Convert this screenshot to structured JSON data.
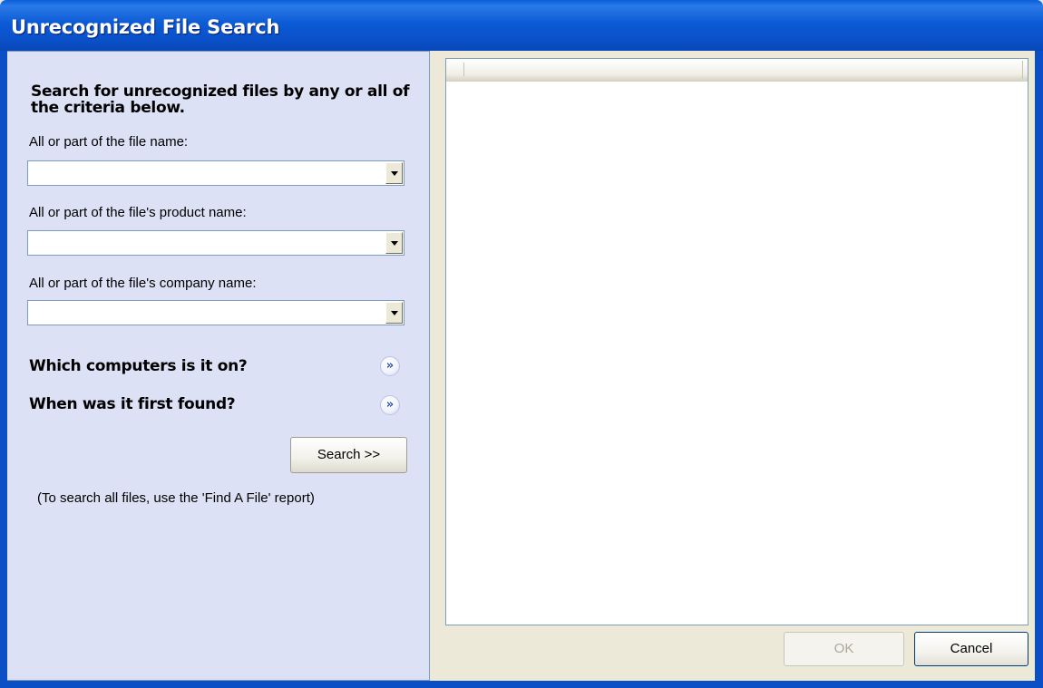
{
  "window": {
    "title": "Unrecognized File Search"
  },
  "search_panel": {
    "heading": "Search for unrecognized files by any or all of the criteria below.",
    "file_name": {
      "label": "All or part of the file name:",
      "value": ""
    },
    "product_name": {
      "label": "All or part of the file's product name:",
      "value": ""
    },
    "company_name": {
      "label": "All or part of the file's company name:",
      "value": ""
    },
    "computers_section": {
      "label": "Which computers is it on?",
      "icon": "expand-chevron-down-icon"
    },
    "first_found_section": {
      "label": "When was it first found?",
      "icon": "expand-chevron-down-icon"
    },
    "search_button": "Search >>",
    "hint": "(To search all files, use the 'Find A File' report)"
  },
  "results": {
    "columns": [],
    "rows": []
  },
  "footer": {
    "ok_label": "OK",
    "ok_enabled": false,
    "cancel_label": "Cancel"
  },
  "colors": {
    "title_bar": "#0a5ed8",
    "panel_bg": "#dce1f5",
    "window_bg": "#ece9d8"
  }
}
